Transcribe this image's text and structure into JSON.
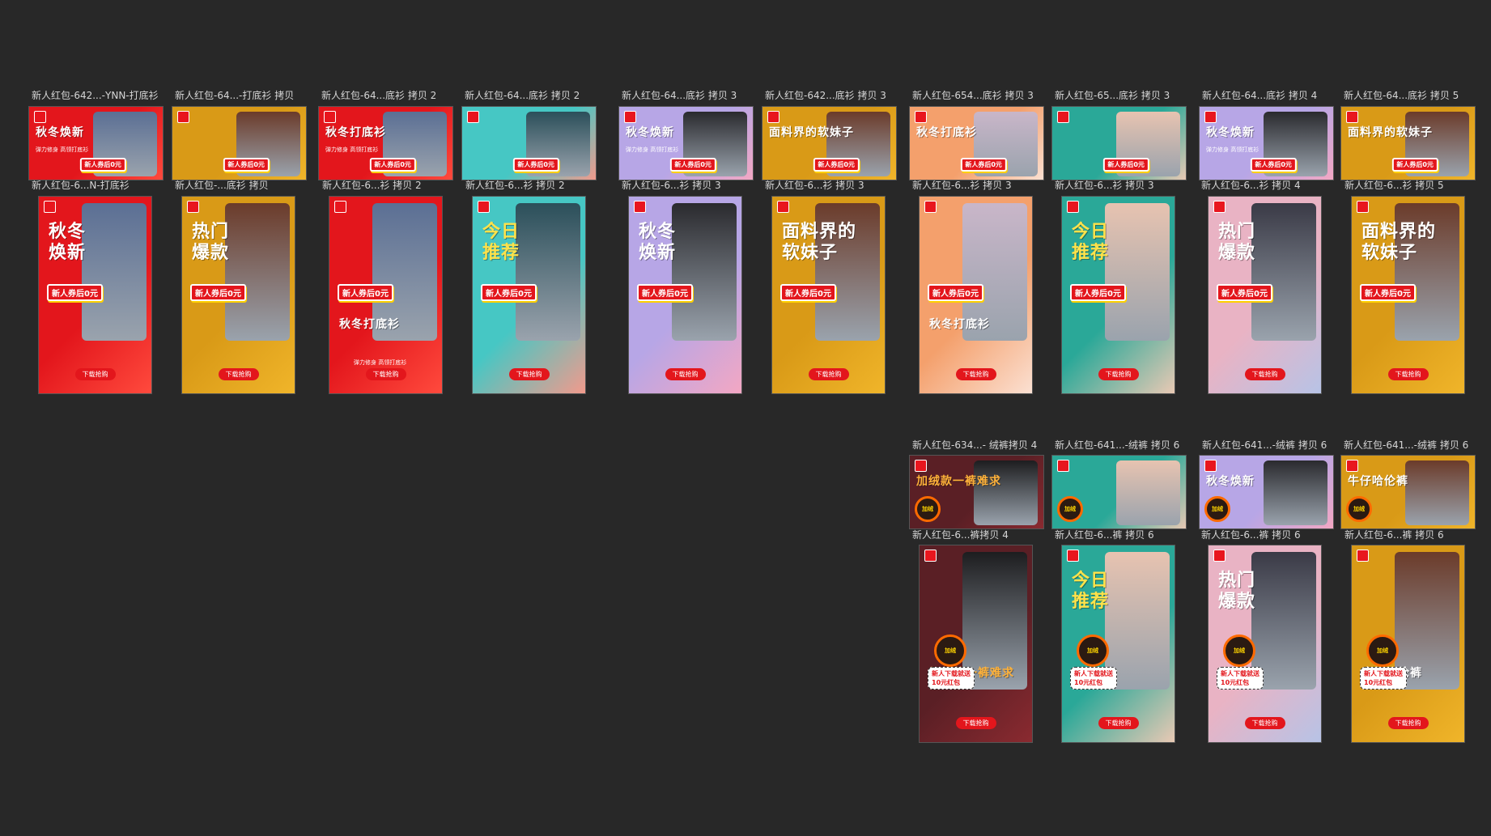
{
  "canvas": {
    "background": "#282828"
  },
  "sections": [
    {
      "id": "tops",
      "rows": [
        {
          "kind": "landscape",
          "items": [
            {
              "label": "新人红包-642...-YNN-打底衫",
              "theme": "red",
              "head": "秋冬焕新",
              "sub": "弹力修身 高领打底衫",
              "coupon": "新人券后0元"
            },
            {
              "label": "新人红包-64...-打底衫 拷贝",
              "theme": "amber",
              "head": "",
              "sub": "",
              "coupon": "新人券后0元"
            },
            {
              "label": "新人红包-64...底衫 拷贝 2",
              "theme": "red",
              "head": "秋冬打底衫",
              "sub": "弹力修身 高领打底衫",
              "coupon": "新人券后0元"
            },
            {
              "label": "新人红包-64...底衫 拷贝 2",
              "theme": "teal",
              "head": "",
              "sub": "",
              "coupon": "新人券后0元"
            },
            {
              "label": "新人红包-64...底衫 拷贝 3",
              "theme": "lilac",
              "head": "秋冬焕新",
              "sub": "弹力修身 高领打底衫",
              "coupon": "新人券后0元"
            },
            {
              "label": "新人红包-642...底衫 拷贝 3",
              "theme": "amber",
              "head": "面料界的软妹子",
              "sub": "",
              "coupon": "新人券后0元"
            },
            {
              "label": "新人红包-654...底衫 拷贝 3",
              "theme": "peach",
              "head": "秋冬打底衫",
              "sub": "",
              "coupon": "新人券后0元"
            },
            {
              "label": "新人红包-65...底衫 拷贝 3",
              "theme": "mint",
              "head": "",
              "sub": "",
              "coupon": "新人券后0元"
            },
            {
              "label": "新人红包-64...底衫 拷贝 4",
              "theme": "lilac",
              "head": "秋冬焕新",
              "sub": "弹力修身 高领打底衫",
              "coupon": "新人券后0元"
            },
            {
              "label": "新人红包-64...底衫 拷贝 5",
              "theme": "amber",
              "head": "面料界的软妹子",
              "sub": "",
              "coupon": "新人券后0元"
            }
          ]
        },
        {
          "kind": "portrait",
          "items": [
            {
              "label": "新人红包-6...N-打底衫",
              "theme": "red",
              "head": "秋冬\n焕新",
              "sub": "",
              "coupon": "新人券后0元",
              "cta": "下载抢购"
            },
            {
              "label": "新人红包-...底衫 拷贝",
              "theme": "amber",
              "head": "热门\n爆款",
              "sub": "",
              "coupon": "新人券后0元",
              "cta": "下载抢购"
            },
            {
              "label": "新人红包-6...衫 拷贝 2",
              "theme": "red",
              "head": "秋冬打底衫",
              "sub": "弹力修身 高领打底衫",
              "coupon": "新人券后0元",
              "cta": "下载抢购"
            },
            {
              "label": "新人红包-6...衫 拷贝 2",
              "theme": "teal",
              "head": "今日\n推荐",
              "sub": "",
              "coupon": "新人券后0元",
              "cta": "下载抢购"
            },
            {
              "label": "新人红包-6...衫 拷贝 3",
              "theme": "lilac",
              "head": "秋冬\n焕新",
              "sub": "",
              "coupon": "新人券后0元",
              "cta": "下载抢购"
            },
            {
              "label": "新人红包-6...衫 拷贝 3",
              "theme": "amber",
              "head": "面料界的\n软妹子",
              "sub": "",
              "coupon": "新人券后0元",
              "cta": "下载抢购"
            },
            {
              "label": "新人红包-6...衫 拷贝 3",
              "theme": "peach",
              "head": "秋冬打底衫",
              "sub": "",
              "coupon": "新人券后0元",
              "cta": "下载抢购"
            },
            {
              "label": "新人红包-6...衫 拷贝 3",
              "theme": "mint",
              "head": "今日\n推荐",
              "sub": "",
              "coupon": "新人券后0元",
              "cta": "下载抢购"
            },
            {
              "label": "新人红包-6...衫 拷贝 4",
              "theme": "marble",
              "head": "热门\n爆款",
              "sub": "",
              "coupon": "新人券后0元",
              "cta": "下载抢购"
            },
            {
              "label": "新人红包-6...衫 拷贝 5",
              "theme": "amber",
              "head": "面料界的\n软妹子",
              "sub": "",
              "coupon": "新人券后0元",
              "cta": "下载抢购"
            }
          ]
        }
      ]
    },
    {
      "id": "pants",
      "rows": [
        {
          "kind": "landscape",
          "items": [
            {
              "label": "新人红包-634...- 绒裤拷贝 4",
              "theme": "maroon",
              "head": "加绒款一裤难求",
              "sub": "",
              "coupon": "",
              "burst": "加绒"
            },
            {
              "label": "新人红包-641...-绒裤 拷贝 6",
              "theme": "mint",
              "head": "",
              "sub": "",
              "coupon": "",
              "burst": "加绒"
            },
            {
              "label": "新人红包-641...-绒裤 拷贝 6",
              "theme": "lilac",
              "head": "秋冬焕新",
              "sub": "",
              "coupon": "",
              "burst": "加绒"
            },
            {
              "label": "新人红包-641...-绒裤 拷贝 6",
              "theme": "amber",
              "head": "牛仔哈伦裤",
              "sub": "",
              "coupon": "",
              "burst": "加绒"
            }
          ]
        },
        {
          "kind": "portrait",
          "items": [
            {
              "label": "新人红包-6...裤拷贝 4",
              "theme": "maroon",
              "head": "加绒款一裤难求",
              "sub": "",
              "coupon": "",
              "bubble": "新人下载就送\n10元红包",
              "burst": "加绒",
              "cta": "下载抢购"
            },
            {
              "label": "新人红包-6...裤 拷贝 6",
              "theme": "mint",
              "head": "今日\n推荐",
              "sub": "",
              "coupon": "",
              "bubble": "新人下载就送\n10元红包",
              "burst": "加绒",
              "cta": "下载抢购"
            },
            {
              "label": "新人红包-6...裤 拷贝 6",
              "theme": "marble",
              "head": "热门\n爆款",
              "sub": "",
              "coupon": "",
              "bubble": "新人下载就送\n10元红包",
              "burst": "加绒",
              "cta": "下载抢购"
            },
            {
              "label": "新人红包-6...裤 拷贝 6",
              "theme": "amber",
              "head": "牛仔哈伦裤",
              "sub": "",
              "coupon": "",
              "bubble": "新人下载就送\n10元红包",
              "burst": "加绒",
              "cta": "下载抢购"
            }
          ]
        }
      ]
    }
  ],
  "themes": {
    "red": {
      "bg": "#e3161c",
      "bg2": "#ff4a3d",
      "photo": "#5b6f94",
      "head": "#ffffff"
    },
    "amber": {
      "bg": "#d99a17",
      "bg2": "#f0b52a",
      "photo": "#6b3b2a",
      "head": "#ffffff"
    },
    "teal": {
      "bg": "#46c7c4",
      "bg2": "#f29a8c",
      "photo": "#2b4f5a",
      "head": "#ffe24a"
    },
    "lilac": {
      "bg": "#b7a6e6",
      "bg2": "#f3a7c3",
      "photo": "#2a2a2e",
      "head": "#ffffff"
    },
    "peach": {
      "bg": "#f4a06c",
      "bg2": "#fbe0d2",
      "photo": "#c9b6c9",
      "head": "#ffffff"
    },
    "mint": {
      "bg": "#2aa898",
      "bg2": "#e9c9b4",
      "photo": "#e7c3b0",
      "head": "#ffe24a"
    },
    "marble": {
      "bg": "#e9b3c4",
      "bg2": "#b7c3e6",
      "photo": "#3a3a46",
      "head": "#ffffff"
    },
    "maroon": {
      "bg": "#5a1f25",
      "bg2": "#8a2a30",
      "photo": "#1d1d1f",
      "head": "#ffb23a"
    }
  }
}
